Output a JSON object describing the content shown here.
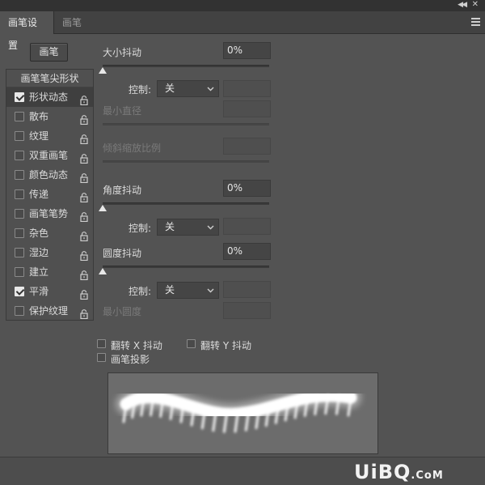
{
  "tabs": [
    {
      "label": "画笔设置",
      "active": true
    },
    {
      "label": "画笔",
      "active": false
    }
  ],
  "brush_button": "画笔",
  "list": {
    "header": "画笔笔尖形状",
    "items": [
      {
        "label": "形状动态",
        "checked": true,
        "selected": true
      },
      {
        "label": "散布",
        "checked": false
      },
      {
        "label": "纹理",
        "checked": false
      },
      {
        "label": "双重画笔",
        "checked": false
      },
      {
        "label": "颜色动态",
        "checked": false
      },
      {
        "label": "传递",
        "checked": false
      },
      {
        "label": "画笔笔势",
        "checked": false
      },
      {
        "label": "杂色",
        "checked": false
      },
      {
        "label": "湿边",
        "checked": false
      },
      {
        "label": "建立",
        "checked": false
      },
      {
        "label": "平滑",
        "checked": true
      },
      {
        "label": "保护纹理",
        "checked": false
      }
    ]
  },
  "settings": {
    "size_jitter": {
      "label": "大小抖动",
      "value": "0%",
      "level": 0
    },
    "control1": {
      "label": "控制:",
      "value": "关"
    },
    "min_diameter": {
      "label": "最小直径"
    },
    "tilt_scale": {
      "label": "倾斜缩放比例"
    },
    "angle_jitter": {
      "label": "角度抖动",
      "value": "0%",
      "level": 0
    },
    "control2": {
      "label": "控制:",
      "value": "关"
    },
    "roundness_jitter": {
      "label": "圆度抖动",
      "value": "0%",
      "level": 0
    },
    "control3": {
      "label": "控制:",
      "value": "关"
    },
    "min_roundness": {
      "label": "最小圆度"
    }
  },
  "flip_x": {
    "label": "翻转 X 抖动",
    "checked": false
  },
  "flip_y": {
    "label": "翻转 Y 抖动",
    "checked": false
  },
  "brush_projection": {
    "label": "画笔投影",
    "checked": false
  },
  "watermark": {
    "a": "UiBQ",
    "b": ".CoM"
  },
  "colors": {
    "panel": "#535353",
    "dark": "#323232",
    "text": "#dcdcdc"
  }
}
